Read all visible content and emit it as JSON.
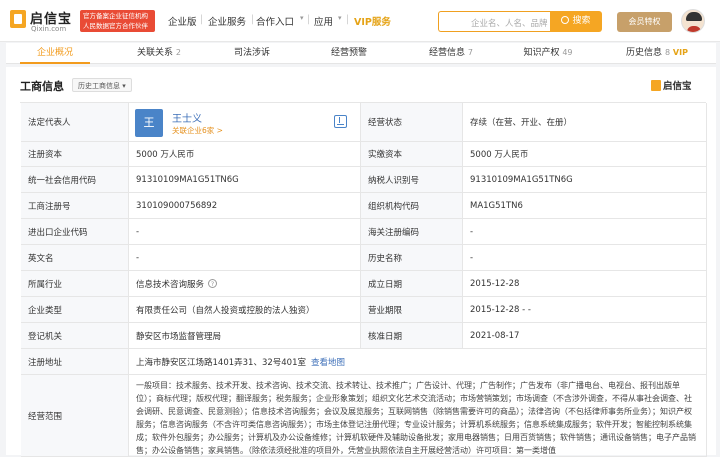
{
  "header": {
    "logo_title": "启信宝",
    "logo_domain": "Qixin.com",
    "gov_badge_line1": "官方备案企业征信机构",
    "gov_badge_line2": "人民数据官方合作伙伴",
    "nav": [
      "企业版",
      "企业服务",
      "合作入口",
      "应用",
      "VIP服务"
    ],
    "search_placeholder": "企业名、人名、品牌",
    "search_button": "搜索",
    "member_button": "会员特权"
  },
  "tabs": [
    {
      "label": "企业概况",
      "count": ""
    },
    {
      "label": "关联关系",
      "count": "2"
    },
    {
      "label": "司法涉诉",
      "count": ""
    },
    {
      "label": "经营预警",
      "count": ""
    },
    {
      "label": "经营信息",
      "count": "7"
    },
    {
      "label": "知识产权",
      "count": "49"
    },
    {
      "label": "历史信息",
      "count": "8",
      "vip": "VIP"
    }
  ],
  "section": {
    "title": "工商信息",
    "history_tag": "历史工商信息",
    "brand": "启信宝"
  },
  "legal_rep": {
    "label": "法定代表人",
    "avatar_char": "王",
    "name": "王士义",
    "related": "关联企业6家 >"
  },
  "status": {
    "label": "经营状态",
    "value": "存续（在营、开业、在册）"
  },
  "rows": [
    {
      "l1": "注册资本",
      "v1": "5000 万人民币",
      "l2": "实缴资本",
      "v2": "5000 万人民币"
    },
    {
      "l1": "统一社会信用代码",
      "v1": "91310109MA1G51TN6G",
      "l2": "纳税人识别号",
      "v2": "91310109MA1G51TN6G"
    },
    {
      "l1": "工商注册号",
      "v1": "310109000756892",
      "l2": "组织机构代码",
      "v2": "MA1G51TN6"
    },
    {
      "l1": "进出口企业代码",
      "v1": "-",
      "l2": "海关注册编码",
      "v2": "-"
    },
    {
      "l1": "英文名",
      "v1": "-",
      "l2": "历史名称",
      "v2": "-"
    },
    {
      "l1": "所属行业",
      "v1": "信息技术咨询服务",
      "l2": "成立日期",
      "v2": "2015-12-28"
    },
    {
      "l1": "企业类型",
      "v1": "有限责任公司（自然人投资或控股的法人独资）",
      "l2": "营业期限",
      "v2": "2015-12-28 - -"
    },
    {
      "l1": "登记机关",
      "v1": "静安区市场监督管理局",
      "l2": "核准日期",
      "v2": "2021-08-17"
    }
  ],
  "address": {
    "label": "注册地址",
    "value": "上海市静安区江场路1401弄31、32号401室",
    "link": "查看地图"
  },
  "scope": {
    "label": "经营范围",
    "value": "一般项目：技术服务、技术开发、技术咨询、技术交流、技术转让、技术推广；广告设计、代理；广告制作；广告发布（非广播电台、电视台、报刊出版单位）；商标代理；版权代理；翻译服务；税务服务；企业形象策划；组织文化艺术交流活动；市场营销策划；市场调查（不含涉外调查，不得从事社会调查、社会调研、民意调查、民意测验）；信息技术咨询服务；会议及展览服务；互联网销售（除销售需要许可的商品）；法律咨询（不包括律师事务所业务）；知识产权服务；信息咨询服务（不含许可类信息咨询服务）；市场主体登记注册代理；专业设计服务；计算机系统服务；信息系统集成服务；软件开发；智能控制系统集成；软件外包服务；办公服务；计算机及办公设备维修；计算机软硬件及辅助设备批发；家用电器销售；日用百货销售；软件销售；通讯设备销售；电子产品销售；办公设备销售；家具销售。（除依法须经批准的项目外，凭营业执照依法自主开展经营活动）许可项目：第一类增值"
  }
}
